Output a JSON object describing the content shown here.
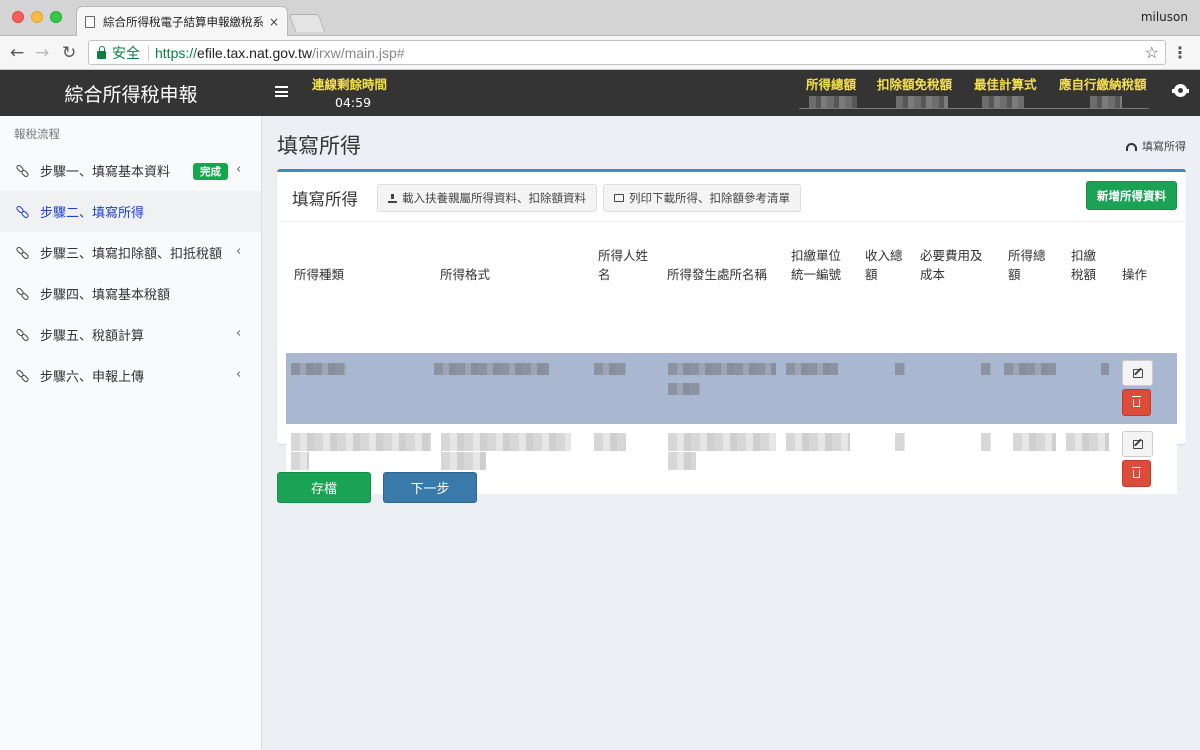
{
  "browser": {
    "tab_title": "綜合所得稅電子結算申報繳稅系統",
    "tab_close": "×",
    "user": "miluson",
    "secure_label": "安全",
    "url_proto": "https://",
    "url_host": "efile.tax.nat.gov.tw",
    "url_path": "/irxw/main.jsp#",
    "back": "←",
    "forward": "→",
    "reload": "↻",
    "star": "☆",
    "menu": "⋮"
  },
  "header": {
    "brand": "綜合所得稅申報",
    "timer_label": "連線剩餘時間",
    "timer_value": "04:59",
    "columns": [
      "所得總額",
      "扣除額免稅額",
      "最佳計算式",
      "應自行繳納稅額"
    ],
    "accent_color": "#f5e14a"
  },
  "sidebar": {
    "header": "報稅流程",
    "items": [
      {
        "label": "步驟一、填寫基本資料",
        "badge": "完成",
        "chevron": "‹"
      },
      {
        "label": "步驟二、填寫所得"
      },
      {
        "label": "步驟三、填寫扣除額、扣抵稅額",
        "chevron": "‹"
      },
      {
        "label": "步驟四、填寫基本稅額"
      },
      {
        "label": "步驟五、稅額計算",
        "chevron": "‹"
      },
      {
        "label": "步驟六、申報上傳",
        "chevron": "‹"
      }
    ]
  },
  "main": {
    "page_title": "填寫所得",
    "breadcrumb": "填寫所得",
    "panel_title": "填寫所得",
    "btn_load": "載入扶養親屬所得資料、扣除額資料",
    "btn_print": "列印下載所得、扣除額參考清單",
    "btn_add": "新增所得資料",
    "columns": {
      "type": "所得種類",
      "format": "所得格式",
      "name1": "所得人姓",
      "name2": "名",
      "payer": "所得發生處所名稱",
      "unit1": "扣繳單位",
      "unit2": "統一編號",
      "income1": "收入總",
      "income2": "額",
      "cost1": "必要費用及",
      "cost2": "成本",
      "total1": "所得總",
      "total2": "額",
      "tax1": "扣繳",
      "tax2": "稅額",
      "action": "操作"
    },
    "btn_save": "存檔",
    "btn_next": "下一步"
  },
  "colors": {
    "primary": "#3c8dbc",
    "success": "#1aa355",
    "danger": "#dd4b39",
    "selected_row": "#a9b8d0"
  }
}
